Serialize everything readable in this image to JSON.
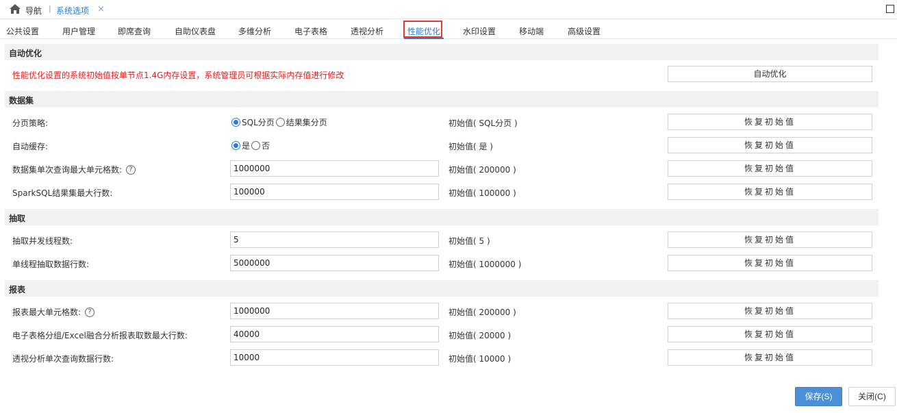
{
  "nav": {
    "home_icon": "home-icon",
    "title": "导航",
    "separator": "|",
    "tab_label": "系统选项",
    "close_glyph": "×"
  },
  "tabs": [
    {
      "label": "公共设置"
    },
    {
      "label": "用户管理"
    },
    {
      "label": "即席查询"
    },
    {
      "label": "自助仪表盘"
    },
    {
      "label": "多维分析"
    },
    {
      "label": "电子表格"
    },
    {
      "label": "透视分析"
    },
    {
      "label": "性能优化",
      "active": true
    },
    {
      "label": "水印设置"
    },
    {
      "label": "移动端"
    },
    {
      "label": "高级设置"
    }
  ],
  "auto_opt": {
    "header": "自动优化",
    "warning": "性能优化设置的系统初始值按单节点1.4G内存设置，系统管理员可根据实际内存值进行修改",
    "button": "自动优化"
  },
  "dataset": {
    "header": "数据集",
    "paging": {
      "label": "分页策略:",
      "option1": "SQL分页",
      "option2": "结果集分页",
      "selected": "SQL分页",
      "init": "初始值( SQL分页 )",
      "button": "恢复初始值"
    },
    "cache": {
      "label": "自动缓存:",
      "option1": "是",
      "option2": "否",
      "selected": "是",
      "init": "初始值( 是 )",
      "button": "恢复初始值"
    },
    "max_cells": {
      "label": "数据集单次查询最大单元格数:",
      "value": "1000000",
      "init": "初始值( 200000 )",
      "button": "恢复初始值"
    },
    "spark_rows": {
      "label": "SparkSQL结果集最大行数:",
      "value": "100000",
      "init": "初始值( 100000 )",
      "button": "恢复初始值"
    }
  },
  "extract": {
    "header": "抽取",
    "threads": {
      "label": "抽取并发线程数:",
      "value": "5",
      "init": "初始值( 5 )",
      "button": "恢复初始值"
    },
    "rows_per_thread": {
      "label": "单线程抽取数据行数:",
      "value": "5000000",
      "init": "初始值( 1000000 )",
      "button": "恢复初始值"
    }
  },
  "report": {
    "header": "报表",
    "max_cells": {
      "label": "报表最大单元格数:",
      "value": "1000000",
      "init": "初始值( 200000 )",
      "button": "恢复初始值"
    },
    "excel_rows": {
      "label": "电子表格分组/Excel融合分析报表取数最大行数:",
      "value": "40000",
      "init": "初始值( 20000 )",
      "button": "恢复初始值"
    },
    "pivot_rows": {
      "label": "透视分析单次查询数据行数:",
      "value": "10000",
      "init": "初始值( 10000 )",
      "button": "恢复初始值"
    }
  },
  "help_glyph": "?",
  "footer": {
    "save": "保存(S)",
    "close": "关闭(C)"
  },
  "colors": {
    "accent": "#2b7cd3",
    "warning": "#e02020",
    "highlight_box": "#e53935",
    "save_button": "#4a90d9"
  }
}
